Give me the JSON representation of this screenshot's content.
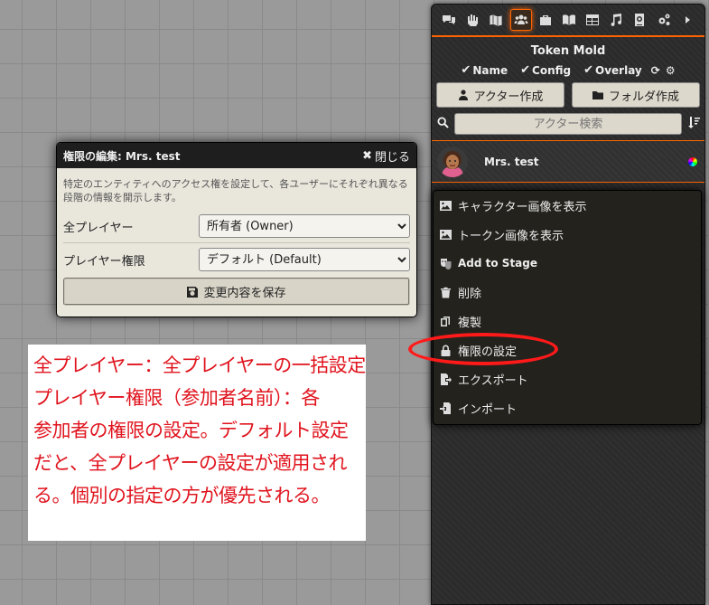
{
  "sidebar": {
    "tabs": [
      {
        "name": "chat-tab",
        "icon": "chat-bubbles-icon"
      },
      {
        "name": "combat-tab",
        "icon": "fist-icon"
      },
      {
        "name": "scenes-tab",
        "icon": "map-icon"
      },
      {
        "name": "actors-tab",
        "icon": "users-icon",
        "active": true
      },
      {
        "name": "items-tab",
        "icon": "suitcase-icon"
      },
      {
        "name": "journal-tab",
        "icon": "book-icon"
      },
      {
        "name": "tables-tab",
        "icon": "table-icon"
      },
      {
        "name": "playlists-tab",
        "icon": "music-icon"
      },
      {
        "name": "compendium-tab",
        "icon": "atlas-icon"
      },
      {
        "name": "settings-tab",
        "icon": "cogs-icon"
      },
      {
        "name": "collapse-tab",
        "icon": "caret-right-icon"
      }
    ],
    "token_mold": {
      "title": "Token Mold",
      "options": [
        "Name",
        "Config",
        "Overlay"
      ]
    },
    "buttons": {
      "create_actor": "アクター作成",
      "create_folder": "フォルダ作成"
    },
    "search": {
      "placeholder": "アクター検索"
    },
    "actor": {
      "name": "Mrs. test"
    }
  },
  "context_menu": {
    "items": [
      {
        "label": "キャラクター画像を表示",
        "icon": "image-icon"
      },
      {
        "label": "トークン画像を表示",
        "icon": "image-icon"
      },
      {
        "label": "Add to Stage",
        "icon": "theater-masks-icon"
      },
      {
        "label": "削除",
        "icon": "trash-icon"
      },
      {
        "label": "複製",
        "icon": "copy-icon"
      },
      {
        "label": "権限の設定",
        "icon": "lock-icon"
      },
      {
        "label": "エクスポート",
        "icon": "file-export-icon"
      },
      {
        "label": "インポート",
        "icon": "file-import-icon"
      }
    ]
  },
  "permission_dialog": {
    "title": "権限の編集: Mrs. test",
    "close_label": "閉じる",
    "description": "特定のエンティティへのアクセス権を設定して、各ユーザーにそれぞれ異なる段階の情報を開示します。",
    "all_players_label": "全プレイヤー",
    "all_players_value": "所有者 (Owner)",
    "player_label": "プレイヤー権限",
    "player_value": "デフォルト (Default)",
    "save_label": "変更内容を保存"
  },
  "annotation": {
    "lines": [
      "全プレイヤー：全プレイヤーの一括設定",
      "プレイヤー権限（参加者名前）：各",
      "参加者の権限の設定。デフォルト設定",
      "だと、全プレイヤーの設定が適用され",
      "る。個別の指定の方が優先される。"
    ],
    "color": "#e0141e"
  },
  "colors": {
    "accent": "#ff6400",
    "highlight": "#ff1a1a"
  }
}
